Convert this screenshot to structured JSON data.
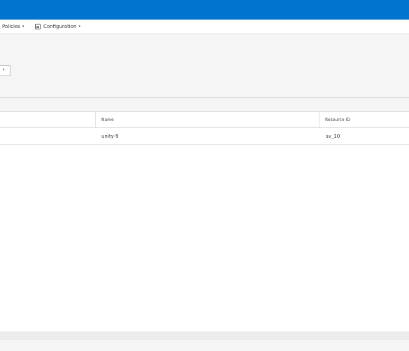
{
  "nav": {
    "policies_label": "Policies",
    "configuration_label": "Configuration",
    "caret_glyph": "▾",
    "configuration_icon": "config-icon"
  },
  "filter": {
    "caret_glyph": "▾"
  },
  "grid": {
    "columns": [
      "Name",
      "Resource ID"
    ],
    "rows": [
      {
        "name": "unity-9",
        "resource_id": "sv_10"
      }
    ]
  },
  "colors": {
    "brand_bar": "#0074cf",
    "background": "#f5f5f5",
    "grid_background": "#ffffff"
  }
}
